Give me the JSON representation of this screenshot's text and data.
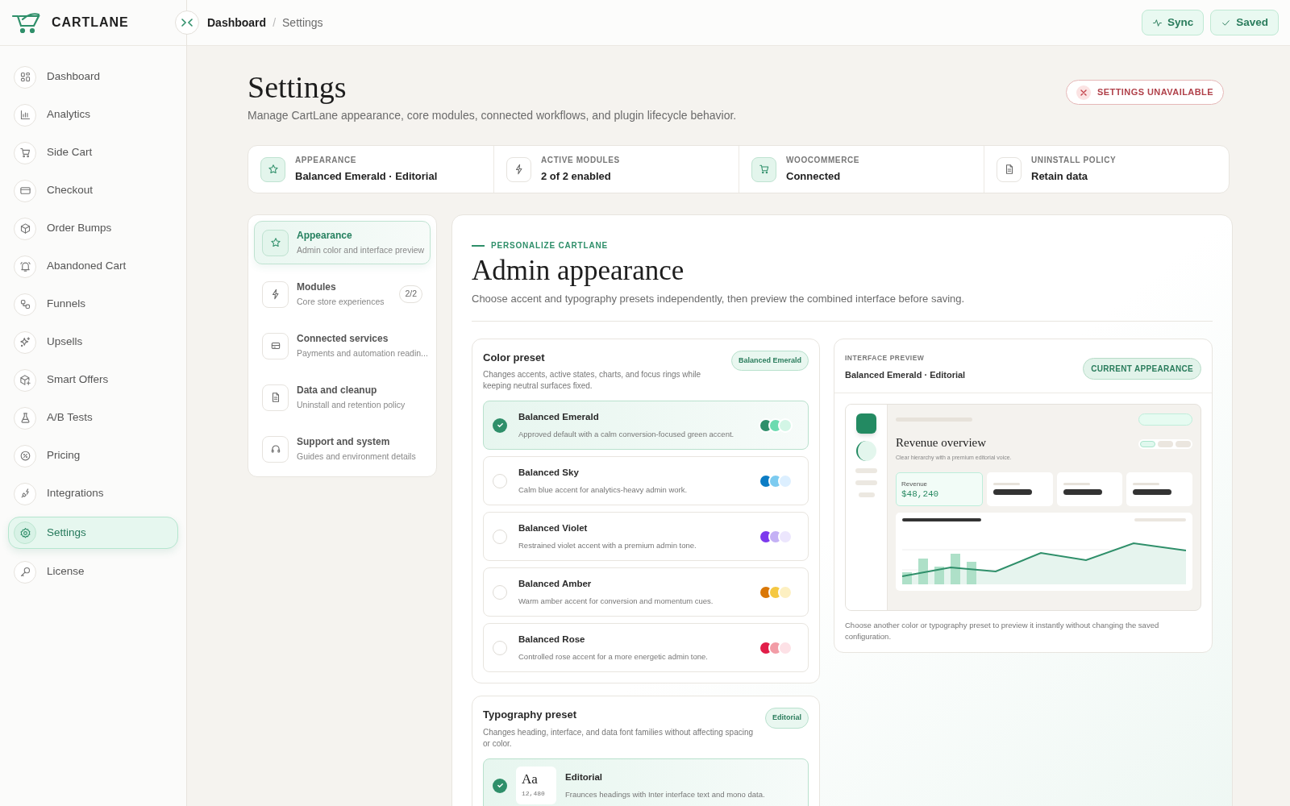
{
  "brand": {
    "name": "CARTLANE"
  },
  "sidebar": {
    "items": [
      {
        "label": "Dashboard",
        "selected": false
      },
      {
        "label": "Analytics",
        "selected": false
      },
      {
        "label": "Side Cart",
        "selected": false
      },
      {
        "label": "Checkout",
        "selected": false
      },
      {
        "label": "Order Bumps",
        "selected": false
      },
      {
        "label": "Abandoned Cart",
        "selected": false
      },
      {
        "label": "Funnels",
        "selected": false
      },
      {
        "label": "Upsells",
        "selected": false
      },
      {
        "label": "Smart Offers",
        "selected": false
      },
      {
        "label": "A/B Tests",
        "selected": false
      },
      {
        "label": "Pricing",
        "selected": false
      },
      {
        "label": "Integrations",
        "selected": false
      },
      {
        "label": "Settings",
        "selected": true
      },
      {
        "label": "License",
        "selected": false
      }
    ]
  },
  "breadcrumb": {
    "items": [
      "Dashboard",
      "Settings"
    ],
    "separator": "/"
  },
  "header_buttons": [
    "Sync",
    "Saved"
  ],
  "page": {
    "title": "Settings",
    "subtitle": "Manage CartLane appearance, core modules, connected workflows, and plugin lifecycle behavior.",
    "status_badge": "SETTINGS UNAVAILABLE"
  },
  "summary": [
    {
      "label": "APPEARANCE",
      "value": "Balanced Emerald · Editorial",
      "highlighted": true
    },
    {
      "label": "ACTIVE MODULES",
      "value": "2 of 2 enabled",
      "highlighted": false
    },
    {
      "label": "WOOCOMMERCE",
      "value": "Connected",
      "highlighted": true
    },
    {
      "label": "UNINSTALL POLICY",
      "value": "Retain data",
      "highlighted": false
    }
  ],
  "settings_nav": [
    {
      "title": "Appearance",
      "description": "Admin color and interface preview",
      "selected": true
    },
    {
      "title": "Modules",
      "description": "Core store experiences",
      "count": "2/2",
      "selected": false
    },
    {
      "title": "Connected services",
      "description": "Payments and automation readin...",
      "selected": false
    },
    {
      "title": "Data and cleanup",
      "description": "Uninstall and retention policy",
      "selected": false
    },
    {
      "title": "Support and system",
      "description": "Guides and environment details",
      "selected": false
    }
  ],
  "panel": {
    "eyebrow": "PERSONALIZE CARTLANE",
    "title": "Admin appearance",
    "description": "Choose accent and typography presets independently, then preview the combined interface before saving."
  },
  "color_preset": {
    "title": "Color preset",
    "badge": "Balanced Emerald",
    "description": "Changes accents, active states, charts, and focus rings while keeping neutral surfaces fixed.",
    "options": [
      {
        "name": "Balanced Emerald",
        "description": "Approved default with a calm conversion-focused green accent.",
        "selected": true,
        "swatches": [
          {
            "color": "#2f8f6a"
          },
          {
            "color": "#6ddbb0"
          },
          {
            "color": "#d3f6e6"
          }
        ]
      },
      {
        "name": "Balanced Sky",
        "description": "Calm blue accent for analytics-heavy admin work.",
        "selected": false,
        "swatches": [
          {
            "color": "#0b7cc4"
          },
          {
            "color": "#7ccbf0"
          },
          {
            "color": "#dcefff"
          }
        ]
      },
      {
        "name": "Balanced Violet",
        "description": "Restrained violet accent with a premium admin tone.",
        "selected": false,
        "swatches": [
          {
            "color": "#7c3aed"
          },
          {
            "color": "#c4b1f5"
          },
          {
            "color": "#ece6fd"
          }
        ]
      },
      {
        "name": "Balanced Amber",
        "description": "Warm amber accent for conversion and momentum cues.",
        "selected": false,
        "swatches": [
          {
            "color": "#d97706"
          },
          {
            "color": "#f5c842"
          },
          {
            "color": "#fdf0c2"
          }
        ]
      },
      {
        "name": "Balanced Rose",
        "description": "Controlled rose accent for a more energetic admin tone.",
        "selected": false,
        "swatches": [
          {
            "color": "#e11d48"
          },
          {
            "color": "#f29ca6"
          },
          {
            "color": "#fde1e6"
          }
        ]
      }
    ]
  },
  "typography_preset": {
    "title": "Typography preset",
    "badge": "Editorial",
    "description": "Changes heading, interface, and data font families without affecting spacing or color.",
    "options": [
      {
        "name": "Editorial",
        "description": "Fraunces headings with Inter interface text and mono data.",
        "sample": "Aa",
        "sample_number": "12,480",
        "selected": true
      }
    ]
  },
  "preview": {
    "eyebrow": "INTERFACE PREVIEW",
    "title": "Balanced Emerald · Editorial",
    "badge": "CURRENT APPEARANCE",
    "mock_title": "Revenue overview",
    "mock_subtitle": "Clear hierarchy with a premium editorial voice.",
    "metric_label": "Revenue",
    "metric_value": "$48,240",
    "footnote": "Choose another color or typography preset to preview it instantly without changing the saved configuration."
  }
}
